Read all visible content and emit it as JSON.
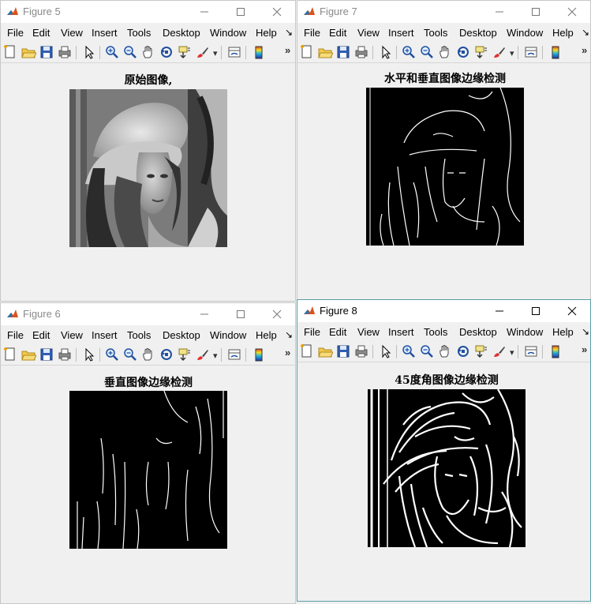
{
  "menu": [
    "File",
    "Edit",
    "View",
    "Insert",
    "Tools",
    "Desktop",
    "Window",
    "Help"
  ],
  "windows": [
    {
      "title": "Figure 5",
      "plot_title": "原始图像,"
    },
    {
      "title": "Figure 7",
      "plot_title": "水平和垂直图像边缘检测"
    },
    {
      "title": "Figure 6",
      "plot_title": "垂直图像边缘检测"
    },
    {
      "title": "Figure 8",
      "plot_title": "45度角图像边缘检测"
    }
  ],
  "overflow_glyph": "»",
  "menu_overflow_glyph": "↘",
  "toolbar_icons": [
    "new-figure-icon",
    "open-file-icon",
    "save-icon",
    "print-icon",
    "edit-plot-icon",
    "zoom-in-icon",
    "zoom-out-icon",
    "pan-icon",
    "rotate-3d-icon",
    "data-cursor-icon",
    "brush-icon",
    "link-plot-icon",
    "colorbar-icon"
  ]
}
